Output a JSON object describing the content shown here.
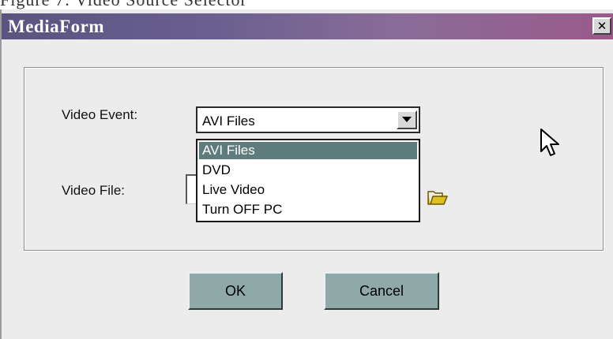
{
  "caption": "Figure 7: Video Source Selector",
  "window": {
    "title": "MediaForm",
    "close_glyph": "✕"
  },
  "form": {
    "video_event_label": "Video Event:",
    "video_file_label": "Video File:",
    "video_event": {
      "selected_value": "AVI Files",
      "options": [
        "AVI Files",
        "DVD",
        "Live Video",
        "Turn OFF PC"
      ],
      "highlighted_index": 0,
      "expanded": true
    },
    "video_file_value": ""
  },
  "buttons": {
    "ok_label": "OK",
    "cancel_label": "Cancel"
  },
  "icons": {
    "folder": "folder-open-icon",
    "cursor": "mouse-pointer-icon"
  },
  "colors": {
    "title_bar_start": "#5a5480",
    "title_bar_end": "#9a5a8a",
    "selection_highlight": "#5e7c7c",
    "button_face": "#8fa8a8",
    "folder": "#e0c020"
  }
}
